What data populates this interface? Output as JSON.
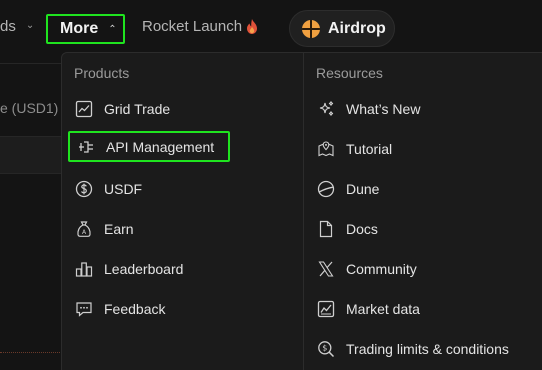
{
  "nav": {
    "cut_label": "ds",
    "more_label": "More",
    "rocket_label": "Rocket Launch",
    "airdrop_label": "Airdrop"
  },
  "background": {
    "label": "e (USD1)"
  },
  "dropdown": {
    "products": {
      "heading": "Products",
      "items": [
        {
          "label": "Grid Trade",
          "icon": "grid-trade-icon"
        },
        {
          "label": "API Management",
          "icon": "api-plug-icon"
        },
        {
          "label": "USDF",
          "icon": "dollar-coin-icon"
        },
        {
          "label": "Earn",
          "icon": "money-bag-icon"
        },
        {
          "label": "Leaderboard",
          "icon": "leaderboard-icon"
        },
        {
          "label": "Feedback",
          "icon": "feedback-icon"
        }
      ]
    },
    "resources": {
      "heading": "Resources",
      "items": [
        {
          "label": "What’s New",
          "icon": "sparkle-icon"
        },
        {
          "label": "Tutorial",
          "icon": "map-pin-icon"
        },
        {
          "label": "Dune",
          "icon": "dune-icon"
        },
        {
          "label": "Docs",
          "icon": "document-icon"
        },
        {
          "label": "Community",
          "icon": "x-logo-icon"
        },
        {
          "label": "Market data",
          "icon": "chart-icon"
        },
        {
          "label": "Trading limits & conditions",
          "icon": "search-dollar-icon"
        }
      ]
    }
  },
  "colors": {
    "highlight": "#1fe41f",
    "background": "#141414",
    "menu_bg": "#1b1b1b",
    "flame": "#e0523a",
    "airdrop_accent": "#f0a040"
  }
}
